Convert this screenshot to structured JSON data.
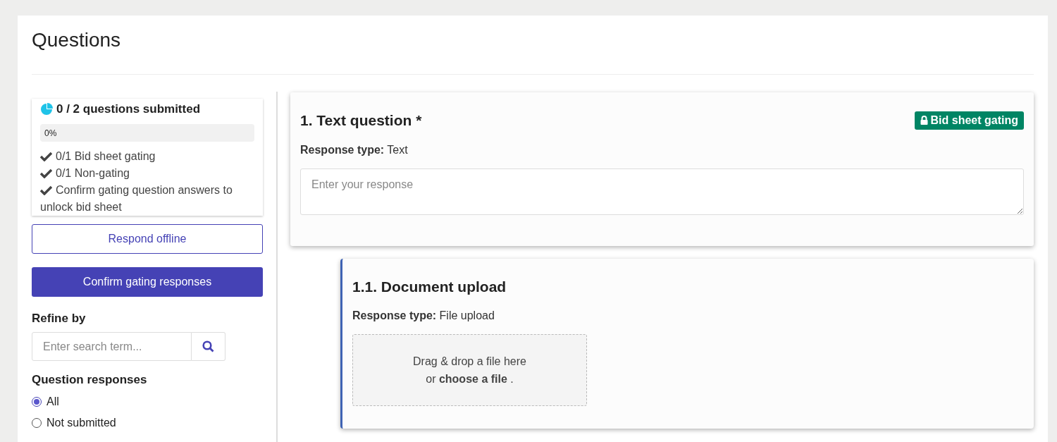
{
  "page": {
    "title": "Questions"
  },
  "summary": {
    "heading": "0 / 2 questions submitted",
    "progress": {
      "level": 0,
      "label": "0%"
    },
    "items": [
      {
        "text": "0/1 Bid sheet gating"
      },
      {
        "text": "0/1 Non-gating"
      },
      {
        "text": "Confirm gating question answers to unlock bid sheet"
      }
    ]
  },
  "buttons": [
    {
      "label": "Respond offline",
      "kind": "outline"
    },
    {
      "label": "Confirm gating responses",
      "kind": "primary"
    }
  ],
  "refine": {
    "heading": "Refine by",
    "search": {
      "placeholder": "Enter search term..."
    }
  },
  "filter": {
    "heading": "Question responses",
    "options": [
      {
        "label": "All",
        "selected": true
      },
      {
        "label": "Not submitted",
        "selected": false
      }
    ]
  },
  "questions": [
    {
      "kind": "text",
      "title": "1. Text question *",
      "badge": "Bid sheet gating",
      "response": "**Response type:** Text",
      "placeholder": "Enter your response",
      "children": [
        {
          "kind": "file",
          "title": "1.1. Document upload",
          "response": "**Response type:** File upload",
          "drop_text": "Drag & drop a file here",
          "choose_text": "or **choose a file** ."
        }
      ]
    }
  ]
}
